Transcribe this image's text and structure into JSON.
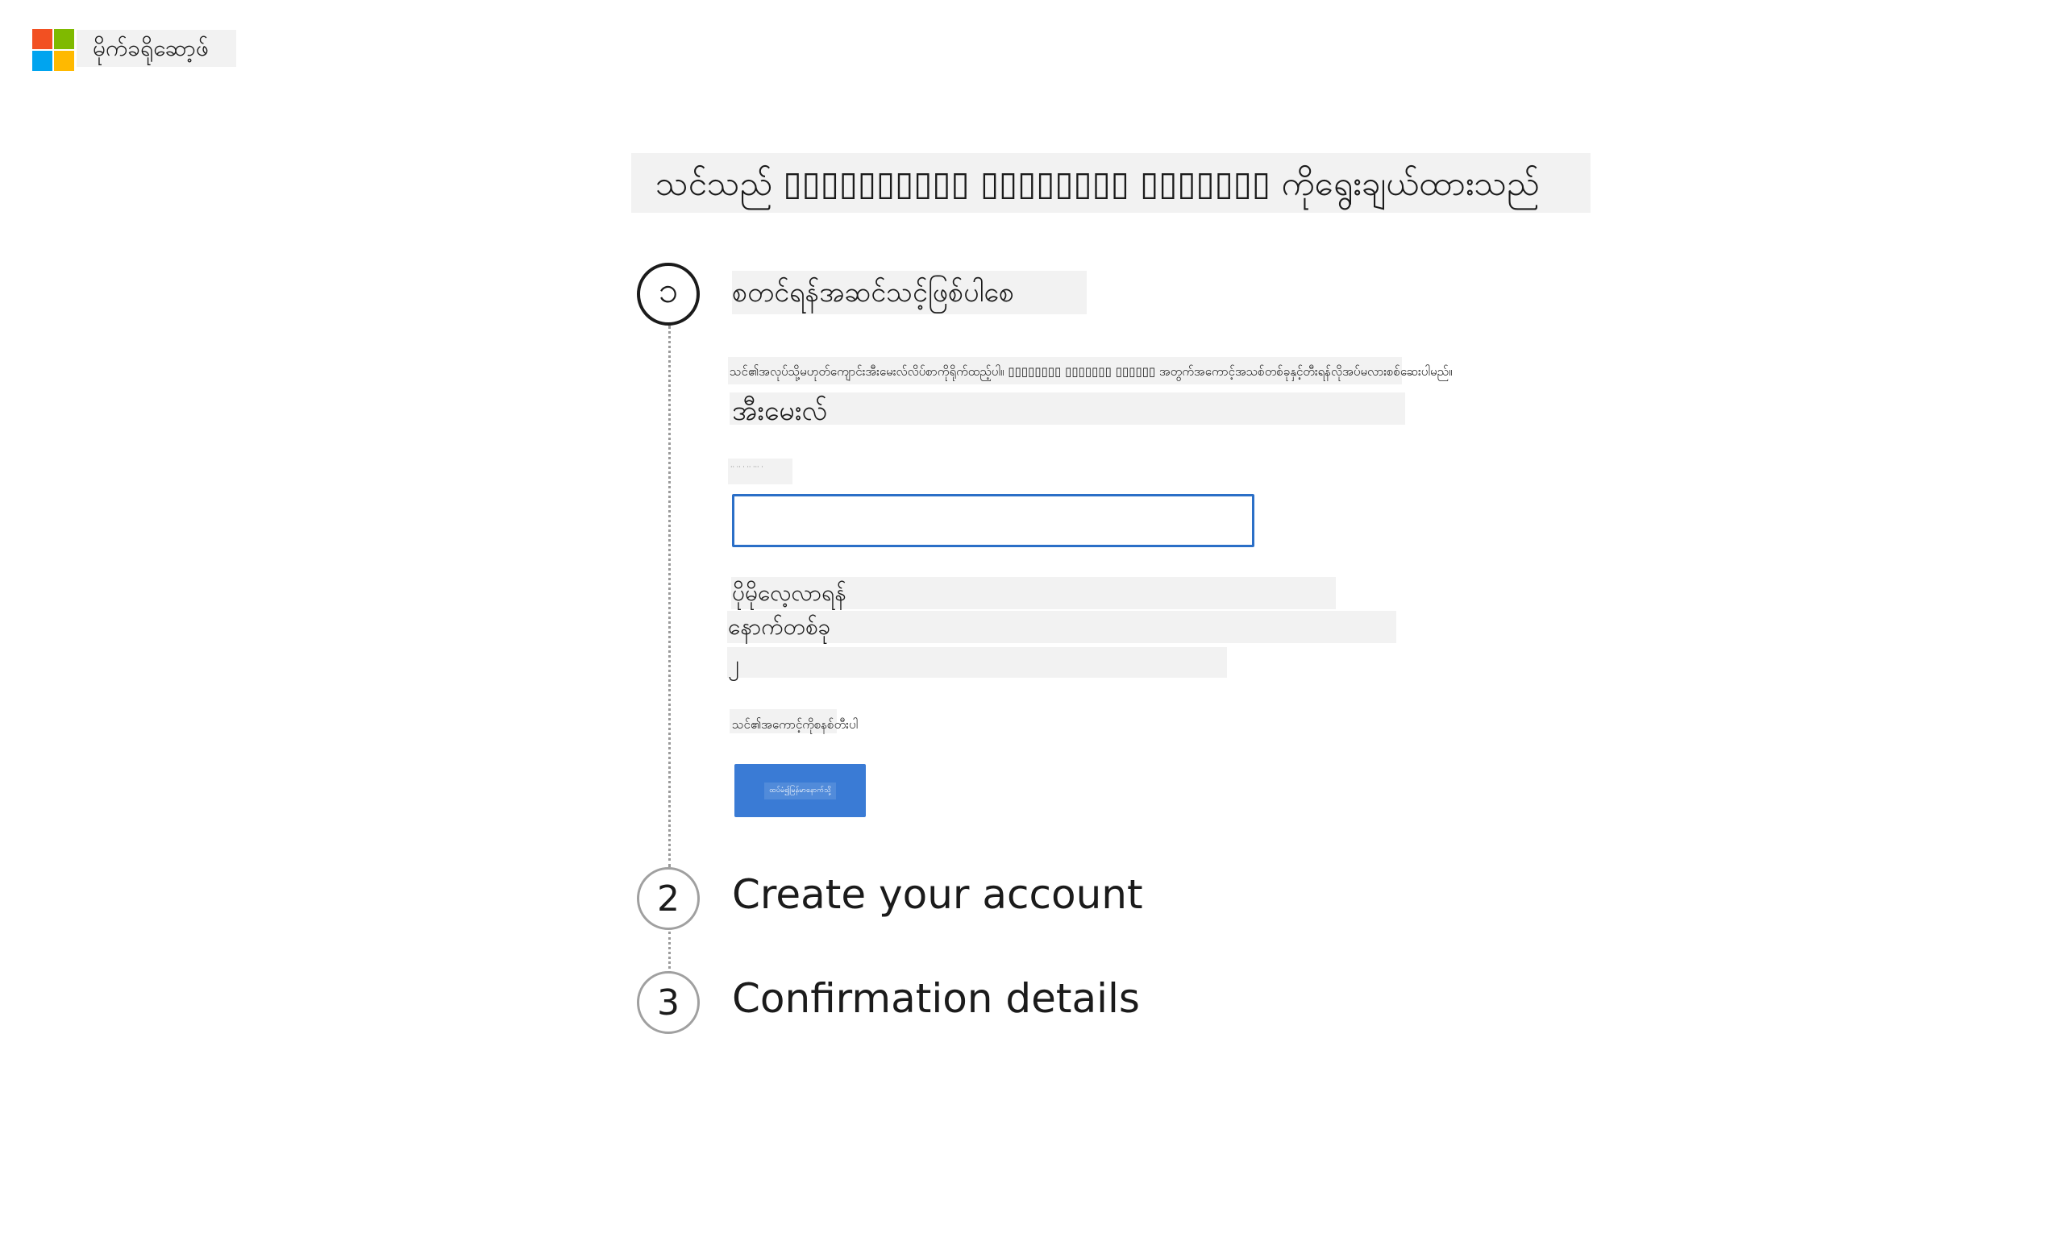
{
  "brand": {
    "name": "မိုက်ခရိုဆော့ဖ်",
    "colors": [
      "#f25022",
      "#7fba00",
      "#00a4ef",
      "#ffb900"
    ]
  },
  "page_title": "သင်သည် ▯▯▯▯▯▯▯▯▯▯ ▯▯▯▯▯▯▯▯ ▯▯▯▯▯▯▯ ကိုရွေးချယ်ထားသည်",
  "steps": [
    {
      "number": "၁",
      "title": "စတင်ရန်အဆင်သင့်ဖြစ်ပါစေ",
      "description": "သင်၏အလုပ်သို့မဟုတ်ကျောင်းအီးမေးလ်လိပ်စာကိုရိုက်ထည့်ပါ။ ▯▯▯▯▯▯▯▯ ▯▯▯▯▯▯▯ ▯▯▯▯▯▯ အတွက်အကောင့်အသစ်တစ်ခုနှင့်တီးရန်လိုအပ်မလားစစ်ဆေးပါမည်။",
      "email_label": "အီးမေးလ်",
      "hint": "·· ·· · ·· ··· ·",
      "email_value": "",
      "email_placeholder": "",
      "options": [
        "ပိုမိုလေ့လာရန်",
        "နောက်တစ်ခု",
        "၂"
      ],
      "account_link": "သင်၏အကောင့်ကိုစနစ်တီးပါ",
      "next_button": "ထပ်မံ၍မြန်မာနောက်သို့"
    },
    {
      "number": "2",
      "title": "Create your account"
    },
    {
      "number": "3",
      "title": "Confirmation details"
    }
  ]
}
